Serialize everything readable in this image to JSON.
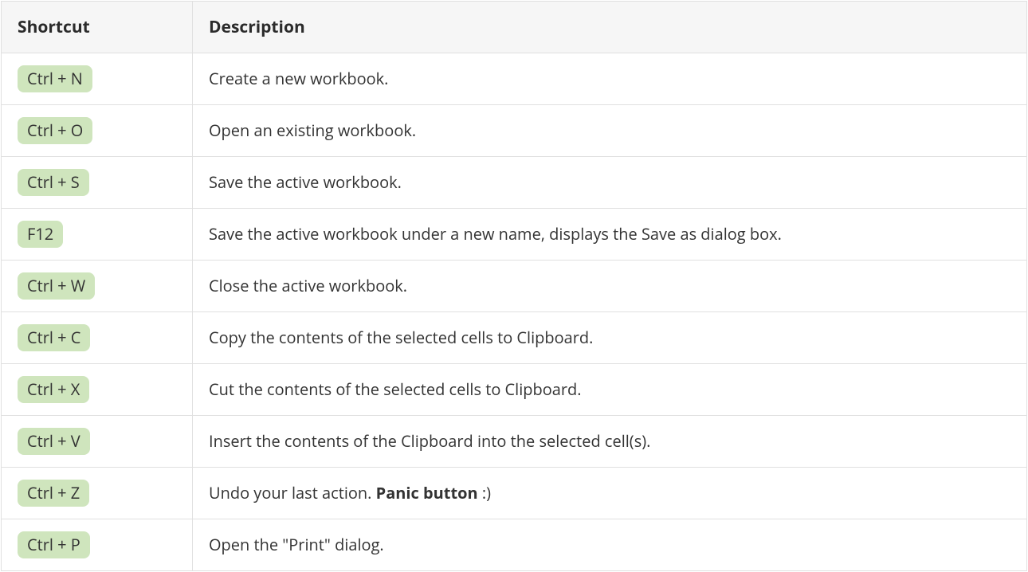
{
  "headers": {
    "shortcut": "Shortcut",
    "description": "Description"
  },
  "rows": [
    {
      "shortcut": "Ctrl + N",
      "description": "Create a new workbook."
    },
    {
      "shortcut": "Ctrl + O",
      "description": "Open an existing workbook."
    },
    {
      "shortcut": "Ctrl + S",
      "description": "Save the active workbook."
    },
    {
      "shortcut": "F12",
      "description": "Save the active workbook under a new name, displays the Save as dialog box."
    },
    {
      "shortcut": "Ctrl + W",
      "description": "Close the active workbook."
    },
    {
      "shortcut": "Ctrl + C",
      "description": "Copy the contents of the selected cells to Clipboard."
    },
    {
      "shortcut": "Ctrl + X",
      "description": "Cut the contents of the selected cells to Clipboard."
    },
    {
      "shortcut": "Ctrl + V",
      "description": "Insert the contents of the Clipboard into the selected cell(s)."
    },
    {
      "shortcut": "Ctrl + Z",
      "description_pre": "Undo your last action. ",
      "description_strong": "Panic button",
      "description_post": " :)"
    },
    {
      "shortcut": "Ctrl + P",
      "description": "Open the \"Print\" dialog."
    }
  ]
}
